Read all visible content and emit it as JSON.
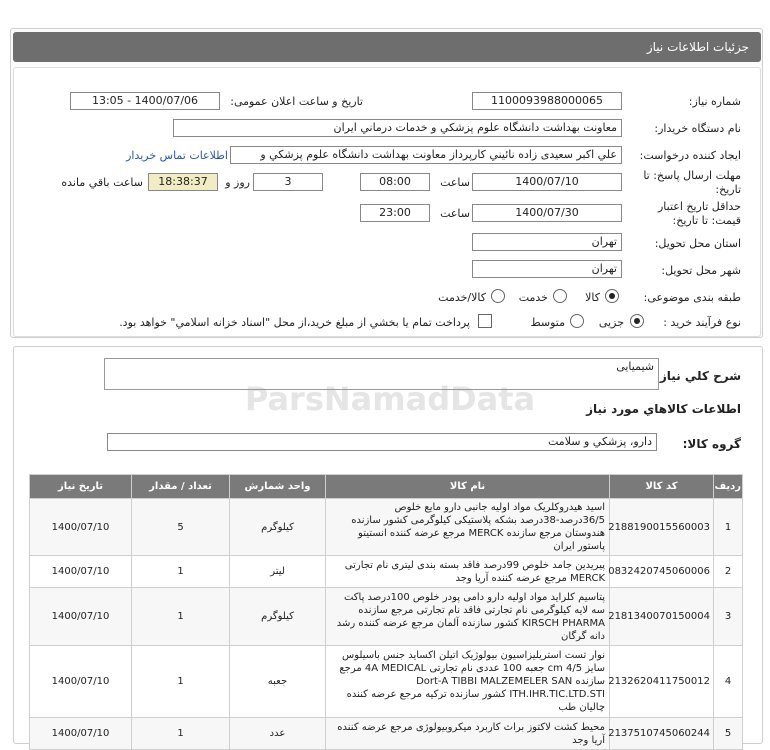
{
  "header": {
    "title": "جزئیات اطلاعات نیاز"
  },
  "form": {
    "need_number_label": "شماره نیاز:",
    "need_number": "1100093988000065",
    "announce_label": "تاریخ و ساعت اعلان عمومی:",
    "announce_value": "1400/07/06 - 13:05",
    "buyer_label": "نام دستگاه خریدار:",
    "buyer_value": "معاونت بهداشت دانشگاه علوم پزشکي و خدمات درماني ایران",
    "creator_label": "ایجاد کننده درخواست:",
    "creator_value": "علي اکبر سعيدی زاده نائيني کارپرداز معاونت بهداشت دانشگاه علوم پزشکي و",
    "contact_link": "اطلاعات تماس خریدار",
    "deadline_label_1": "مهلت ارسال پاسخ: تا",
    "deadline_label_2": "تاریخ:",
    "deadline_date": "1400/07/10",
    "time_label": "ساعت",
    "deadline_time": "08:00",
    "days_value": "3",
    "days_label": "روز و",
    "remaining_time": "18:38:37",
    "remaining_label": "ساعت باقي مانده",
    "validity_label_1": "حداقل تاریخ اعتبار",
    "validity_label_2": "قیمت: تا تاریخ:",
    "validity_date": "1400/07/30",
    "validity_time": "23:00",
    "province_label": "استان محل تحویل:",
    "province_value": "تهران",
    "city_label": "شهر محل تحویل:",
    "city_value": "تهران",
    "category_label": "طبقه بندی موضوعی:",
    "category_options": [
      "کالا",
      "خدمت",
      "کالا/خدمت"
    ],
    "category_selected": "کالا",
    "process_label": "نوع فرآیند خرید :",
    "process_options": [
      "جزیی",
      "متوسط"
    ],
    "process_selected": "جزیی",
    "payment_note": "پرداخت تمام یا بخشي از مبلغ خرید،از محل \"اسناد خزانه اسلامي\" خواهد بود."
  },
  "details": {
    "summary_label": "شرح کلي نیاز:",
    "summary_value": "شیمیایی",
    "items_heading": "اطلاعات کالاهاي مورد نياز",
    "group_label": "گروه کالا:",
    "group_value": "دارو، پزشکي و سلامت"
  },
  "table": {
    "headers": [
      "ردیف",
      "کد کالا",
      "نام کالا",
      "واحد شمارش",
      "تعداد / مقدار",
      "تاریخ نیاز"
    ],
    "rows": [
      {
        "row": "1",
        "code": "2188190015560003",
        "name": "اسید هیدروکلریک مواد اولیه جانبی دارو مایع خلوص 36/5درصد-38درصد بشکه پلاستیکی کیلوگرمی کشور سازنده هندوستان مرجع سازنده MERCK مرجع عرضه کننده انستیتو پاستور ایران",
        "unit": "کیلوگرم",
        "qty": "5",
        "date": "1400/07/10"
      },
      {
        "row": "2",
        "code": "0832420745060006",
        "name": "پیریدین جامد خلوص 99درصد فاقد بسته بندی لیتری نام تجارتی MERCK مرجع عرضه کننده آریا وجد",
        "unit": "لیتر",
        "qty": "1",
        "date": "1400/07/10"
      },
      {
        "row": "3",
        "code": "2181340070150004",
        "name": "پتاسیم کلراید مواد اولیه دارو دامی پودر خلوص 100درصد پاکت سه لایه کیلوگرمی نام تجارتی فاقد نام تجارتی مرجع سازنده KIRSCH PHARMA کشور سازنده آلمان مرجع عرضه کننده رشد دانه گرگان",
        "unit": "کیلوگرم",
        "qty": "1",
        "date": "1400/07/10"
      },
      {
        "row": "4",
        "code": "2132620411750012",
        "name": "نوار تست استریلیزاسیون بیولوژیک اتیلن اکساید جنس باسیلوس سایز 4/5 cm جعبه 100 عددی نام تجارتی 4A MEDICAL مرجع سازنده Dort-A TIBBI MALZEMELER SAN ITH.IHR.TIC.LTD.STI کشور سازنده ترکیه مرجع عرضه کننده چالیان طب",
        "unit": "جعبه",
        "qty": "1",
        "date": "1400/07/10"
      },
      {
        "row": "5",
        "code": "2137510745060244",
        "name": "محیط کشت لاکتوز براث کاربرد میکروبیولوژی مرجع عرضه کننده آریا وجد",
        "unit": "عدد",
        "qty": "1",
        "date": "1400/07/10"
      }
    ]
  }
}
